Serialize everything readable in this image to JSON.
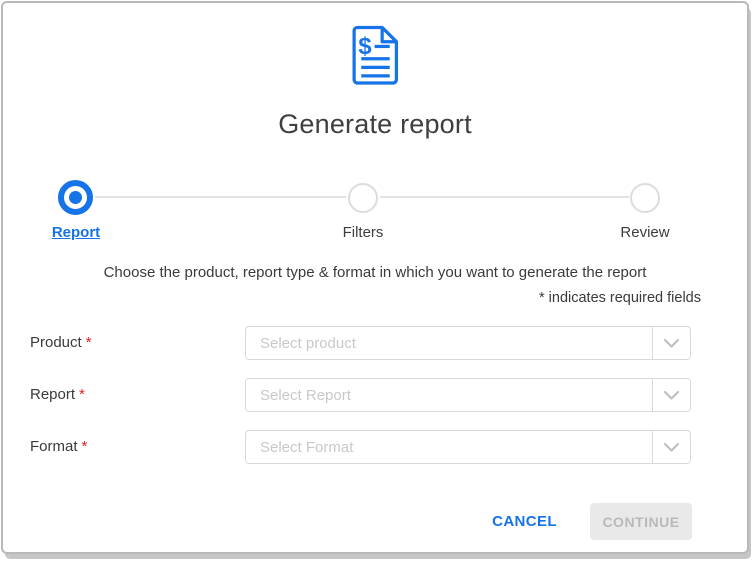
{
  "dialog": {
    "title": "Generate report",
    "description": "Choose the product, report type & format in which you want to generate the report",
    "required_note": "* indicates required fields",
    "required_marker": "*"
  },
  "stepper": {
    "steps": [
      {
        "label": "Report",
        "state": "active"
      },
      {
        "label": "Filters",
        "state": "upcoming"
      },
      {
        "label": "Review",
        "state": "upcoming"
      }
    ]
  },
  "form": {
    "fields": [
      {
        "label": "Product",
        "required": true,
        "placeholder": "Select product",
        "value": ""
      },
      {
        "label": "Report",
        "required": true,
        "placeholder": "Select Report",
        "value": ""
      },
      {
        "label": "Format",
        "required": true,
        "placeholder": "Select Format",
        "value": ""
      }
    ]
  },
  "actions": {
    "cancel_label": "CANCEL",
    "continue_label": "CONTINUE",
    "continue_enabled": false
  },
  "colors": {
    "accent_blue": "#1673e8",
    "required_red": "#e02020",
    "inactive_gray": "#dcdcdc",
    "disabled_bg": "#e9e9e9",
    "disabled_text": "#b9b9b9"
  }
}
